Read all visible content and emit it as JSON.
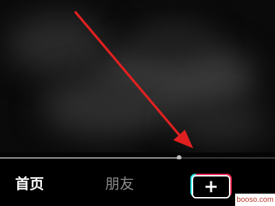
{
  "player": {
    "progress_fraction": 0.65
  },
  "bottom_nav": {
    "items": [
      {
        "label": "首页",
        "active": true
      },
      {
        "label": "朋友",
        "active": false
      }
    ],
    "create_button": {
      "symbol": "+",
      "icon": "plus-icon"
    }
  },
  "annotation": {
    "color": "#e02020"
  },
  "watermark": {
    "text": "booso.com"
  },
  "colors": {
    "background": "#000000",
    "active_text": "#ffffff",
    "inactive_text": "#8a8a8a",
    "accent_cyan": "#25f4ee",
    "accent_red": "#fe2c55"
  }
}
